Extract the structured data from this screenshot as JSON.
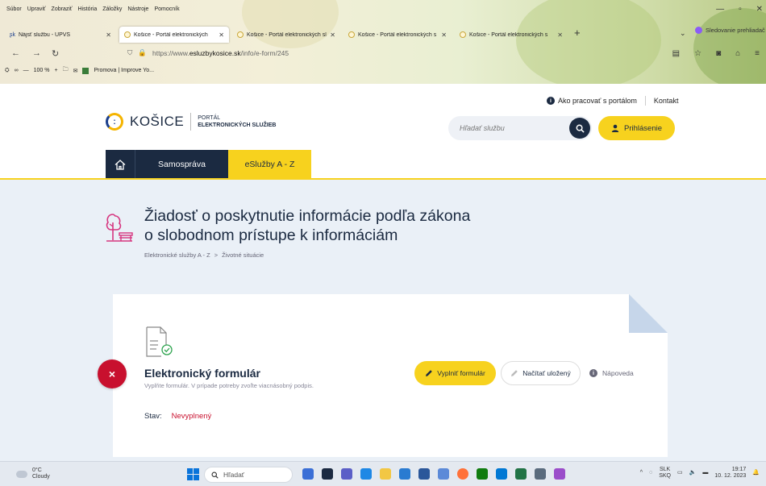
{
  "browser": {
    "menu": [
      "Súbor",
      "Upraviť",
      "Zobraziť",
      "História",
      "Záložky",
      "Nástroje",
      "Pomocník"
    ],
    "tabs": [
      {
        "label": "Nájsť službu - UPVS",
        "active": false
      },
      {
        "label": "Košice - Portál elektronických",
        "active": true
      },
      {
        "label": "Košice - Portál elektronických sl",
        "active": false
      },
      {
        "label": "Košice - Portál elektronických s",
        "active": false
      },
      {
        "label": "Košice - Portál elektronických s",
        "active": false
      }
    ],
    "profile_label": "Sledovanie prehliadač",
    "url_prefix": "https://www.",
    "url_domain": "esluzbykosice.sk",
    "url_path": "/info/e-form/245",
    "zoom": "100 %",
    "bookmarks": [
      "Promova | Improve Yo..."
    ]
  },
  "site": {
    "logo_city": "KOŠICE",
    "logo_portal_line1": "PORTÁL",
    "logo_portal_line2": "ELEKTRONICKÝCH SLUŽIEB",
    "howto_link": "Ako pracovať s portálom",
    "contact_link": "Kontakt",
    "search_placeholder": "Hľadať službu",
    "login_button": "Prihlásenie",
    "nav": {
      "samosprava": "Samospráva",
      "esluzby": "eSlužby A - Z"
    }
  },
  "page": {
    "title_line1": "Žiadosť o poskytnutie informácie podľa zákona",
    "title_line2": "o slobodnom prístupe k informáciám",
    "breadcrumb": [
      "Elektronické služby A - Z",
      "Životné situácie"
    ],
    "breadcrumb_sep": ">"
  },
  "form_card": {
    "title": "Elektronický formulár",
    "subtitle": "Vyplňte formulár. V prípade potreby zvoľte viacnásobný podpis.",
    "fill_button": "Vyplniť formulár",
    "load_button": "Načítať uložený",
    "help_link": "Nápoveda",
    "state_label": "Stav:",
    "state_value": "Nevyplnený",
    "close_symbol": "×"
  },
  "taskbar": {
    "weather_temp": "0°C",
    "weather_desc": "Cloudy",
    "search_placeholder": "Hľadať",
    "lang1": "SLK",
    "lang2": "SKQ",
    "time": "19:17",
    "date": "10. 12. 2023"
  }
}
